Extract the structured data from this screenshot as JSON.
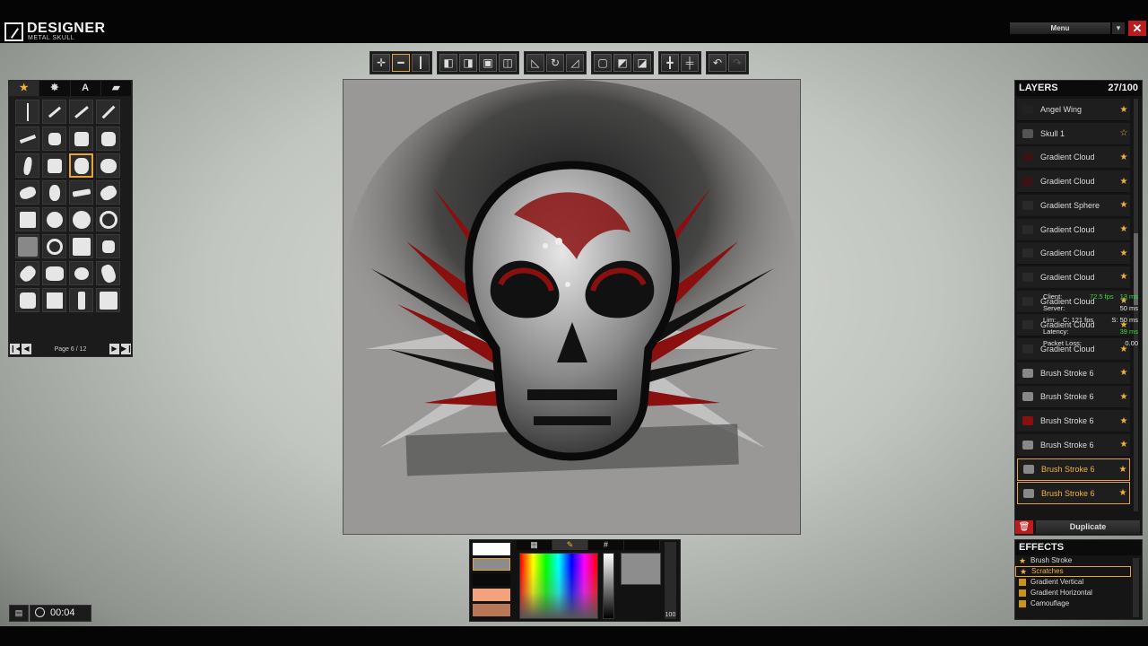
{
  "app": {
    "title": "DESIGNER",
    "subtitle": "METAL SKULL"
  },
  "topbar": {
    "menu_label": "Menu",
    "menu_dropdown_icon": "chevron-down-icon",
    "close_icon": "close-icon"
  },
  "toolbar": {
    "groups": [
      [
        "move-icon",
        "horizontal-line-icon",
        "vertical-line-icon"
      ],
      [
        "align-top-left-icon",
        "align-top-right-icon",
        "align-center-icon",
        "align-split-icon"
      ],
      [
        "skew-left-icon",
        "rotate-icon",
        "skew-right-icon"
      ],
      [
        "layer-front-icon",
        "layer-flip-icon",
        "layer-back-icon"
      ],
      [
        "flip-horizontal-icon",
        "flip-vertical-icon"
      ],
      [
        "undo-icon",
        "redo-icon"
      ]
    ]
  },
  "brushes": {
    "tabs": [
      {
        "icon": "star-icon",
        "glyph": "★"
      },
      {
        "icon": "splat-icon",
        "glyph": "✸"
      },
      {
        "icon": "text-icon",
        "glyph": "A"
      },
      {
        "icon": "folder-icon",
        "glyph": "▰"
      }
    ],
    "selected_index": 10,
    "page_label": "Page 6 / 12",
    "count": 32
  },
  "colors": {
    "swatches": [
      "#ffffff",
      "#8c8c8c",
      "#0a0a0a",
      "#f2a27d",
      "#b87756"
    ],
    "selected_swatch": 1,
    "tabs": [
      "grid-icon",
      "eyedropper-icon",
      "#",
      ""
    ],
    "opacity_label": "100",
    "accent": "#e8a23a"
  },
  "layers": {
    "title": "LAYERS",
    "count": "27/100",
    "items": [
      {
        "name": "Angel Wing",
        "icon_color": "#222",
        "starred": true,
        "selected": false
      },
      {
        "name": "Skull 1",
        "icon_color": "#555",
        "starred": false,
        "selected": false
      },
      {
        "name": "Gradient Cloud",
        "icon_color": "#3a1414",
        "starred": true,
        "selected": false
      },
      {
        "name": "Gradient Cloud",
        "icon_color": "#3a1414",
        "starred": true,
        "selected": false
      },
      {
        "name": "Gradient Sphere",
        "icon_color": "#2a2a2a",
        "starred": true,
        "selected": false
      },
      {
        "name": "Gradient Cloud",
        "icon_color": "#2a2a2a",
        "starred": true,
        "selected": false
      },
      {
        "name": "Gradient Cloud",
        "icon_color": "#2a2a2a",
        "starred": true,
        "selected": false
      },
      {
        "name": "Gradient Cloud",
        "icon_color": "#2a2a2a",
        "starred": true,
        "selected": false
      },
      {
        "name": "Gradient Cloud",
        "icon_color": "#2a2a2a",
        "starred": true,
        "selected": false
      },
      {
        "name": "Gradient Cloud",
        "icon_color": "#2a2a2a",
        "starred": true,
        "selected": false
      },
      {
        "name": "Gradient Cloud",
        "icon_color": "#2a2a2a",
        "starred": true,
        "selected": false
      },
      {
        "name": "Brush Stroke 6",
        "icon_color": "#888",
        "starred": true,
        "selected": false
      },
      {
        "name": "Brush Stroke 6",
        "icon_color": "#888",
        "starred": true,
        "selected": false
      },
      {
        "name": "Brush Stroke 6",
        "icon_color": "#8a1010",
        "starred": true,
        "selected": false
      },
      {
        "name": "Brush Stroke 6",
        "icon_color": "#888",
        "starred": true,
        "selected": false
      },
      {
        "name": "Brush Stroke 6",
        "icon_color": "#888",
        "starred": true,
        "selected": true
      },
      {
        "name": "Brush Stroke 6",
        "icon_color": "#888",
        "starred": true,
        "selected": true
      }
    ],
    "duplicate_label": "Duplicate",
    "delete_icon": "trash-icon"
  },
  "netstats": {
    "client_label": "Client:",
    "client_fps": "72.5 fps",
    "client_ms": "13 ms",
    "server_label": "Server:",
    "server_ms": "50 ms",
    "lim_label": "Lim:",
    "lim_c": "C: 121 fps",
    "lim_s": "S: 50 ms",
    "latency_label": "Latency:",
    "latency_ms": "39 ms",
    "packet_loss_label": "Packet Loss:",
    "packet_loss": "0.00"
  },
  "effects": {
    "title": "EFFECTS",
    "items": [
      {
        "name": "Brush Stroke",
        "selected": false,
        "starred": true
      },
      {
        "name": "Scratches",
        "selected": true,
        "starred": true
      },
      {
        "name": "Gradient Vertical",
        "selected": false,
        "starred": false
      },
      {
        "name": "Gradient Horizontal",
        "selected": false,
        "starred": false
      },
      {
        "name": "Camouflage",
        "selected": false,
        "starred": false
      }
    ]
  },
  "status": {
    "timer": "00:04",
    "chat_icon": "chat-icon",
    "clock_icon": "clock-icon"
  }
}
